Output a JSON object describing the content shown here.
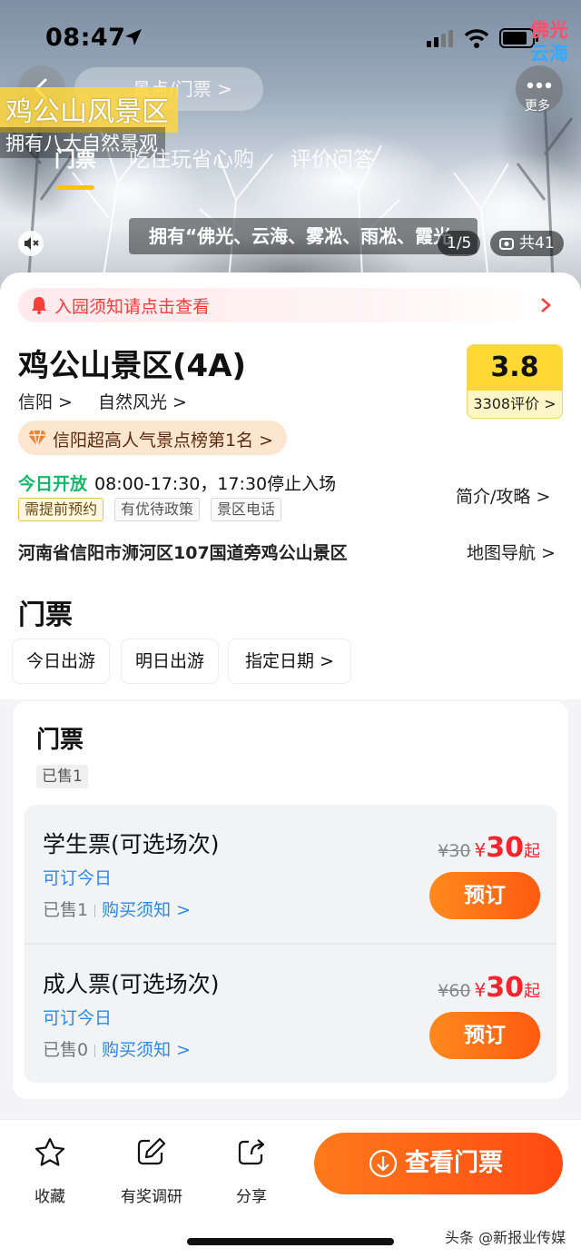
{
  "status_bar": {
    "time": "08:47"
  },
  "watermark_top": {
    "line1": "佛光",
    "line2": "云海"
  },
  "hero": {
    "overlay_title": "鸡公山风景区",
    "overlay_subtitle": "拥有八大自然景观",
    "breadcrumb": "景点/门票 >",
    "more_label": "更多",
    "tabs": [
      {
        "label": "门票",
        "active": true
      },
      {
        "label": "吃住玩省心购",
        "active": false
      },
      {
        "label": "评价问答",
        "active": false
      }
    ],
    "caption": "拥有“佛光、云海、雾凇、雨凇、霞光",
    "counter": "1/5",
    "gallery_count": "共41"
  },
  "notice": {
    "text": "入园须知请点击查看"
  },
  "scenic": {
    "name": "鸡公山景区(4A)",
    "city": "信阳 >",
    "category": "自然风光 >",
    "rating": "3.8",
    "review_count": "3308评价 >",
    "rank": "信阳超高人气景点榜第1名 >",
    "open_status": "今日开放",
    "open_hours": "08:00-17:30，17:30停止入场",
    "tags": [
      "需提前预约",
      "有优待政策",
      "景区电话"
    ],
    "intro_link": "简介/攻略 >",
    "address": "河南省信阳市浉河区107国道旁鸡公山景区",
    "map_link": "地图导航 >"
  },
  "tickets_section": {
    "title": "门票",
    "date_options": [
      "今日出游",
      "明日出游",
      "指定日期 >"
    ]
  },
  "ticket_card": {
    "title": "门票",
    "sold_chip": "已售1",
    "items": [
      {
        "name": "学生票(可选场次)",
        "availability": "可订今日",
        "sold": "已售1",
        "notice": "购买须知 >",
        "original_price": "¥30",
        "currency": "¥",
        "price": "30",
        "suffix": "起",
        "button": "预订"
      },
      {
        "name": "成人票(可选场次)",
        "availability": "可订今日",
        "sold": "已售0",
        "notice": "购买须知 >",
        "original_price": "¥60",
        "currency": "¥",
        "price": "30",
        "suffix": "起",
        "button": "预订"
      }
    ]
  },
  "bottom_bar": {
    "favorite": "收藏",
    "survey": "有奖调研",
    "share": "分享",
    "cta": "查看门票"
  },
  "watermark_bottom": "头条 @新报业传媒",
  "colors": {
    "accent_orange": "#ff5a0f",
    "price_red": "#f5252e",
    "link_blue": "#2e88e8",
    "open_green": "#15b86a",
    "rating_yellow": "#ffd833"
  }
}
